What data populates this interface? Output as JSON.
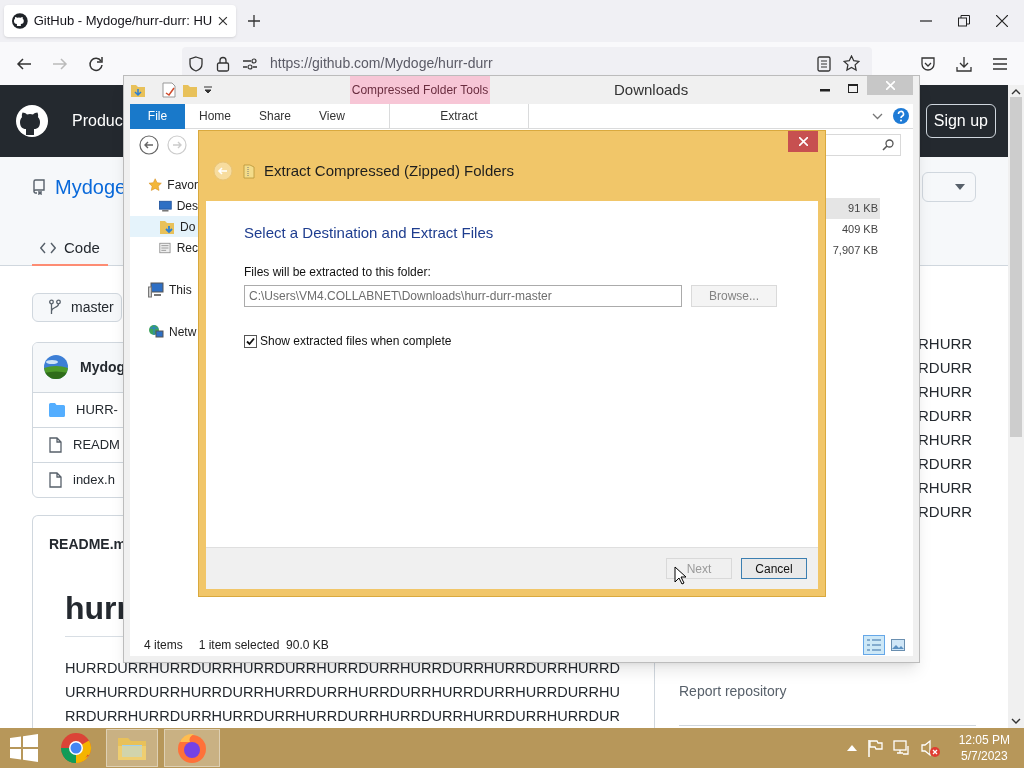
{
  "browser": {
    "tab": {
      "title": "GitHub - Mydoge/hurr-durr: HU",
      "selected": true
    },
    "url": "https://github.com/Mydoge/hurr-durr"
  },
  "github": {
    "nav_item": "Produc",
    "sign_up": "Sign up",
    "repo_name": "Mydoge",
    "repo_tabs": [
      {
        "label": "Code",
        "selected": true
      }
    ],
    "branch": "master",
    "commit_author": "Mydog",
    "files": [
      {
        "kind": "folder",
        "name": "HURR-"
      },
      {
        "kind": "file",
        "name": "READM"
      },
      {
        "kind": "file",
        "name": "index.h"
      }
    ],
    "readme": {
      "title": "README.m",
      "heading": "hurr",
      "lines": [
        "HURRDURRHURRDURRHURRDURRHURRDURRHURRDURRHURRDURRHURRD",
        "URRHURRDURRHURRDURRHURRDURRHURRDURRHURRDURRHURRDURRHU",
        "RRDURRHURRDURRHURRDURRHURRDURRHURRDURRHURRDURRHURRDUR"
      ]
    },
    "side_lines": [
      "RHURR",
      "RDURR",
      "RHURR",
      "RDURR",
      "RHURR",
      "RDURR",
      "RHURR",
      "RDURR"
    ],
    "report_link": "Report repository"
  },
  "explorer": {
    "title": "Downloads",
    "context_group": "Compressed Folder Tools",
    "ribbon_tabs": [
      {
        "label": "File",
        "kind": "menu"
      },
      {
        "label": "Home",
        "kind": "tab"
      },
      {
        "label": "Share",
        "kind": "tab"
      },
      {
        "label": "View",
        "kind": "tab"
      },
      {
        "label": "Extract",
        "kind": "context"
      }
    ],
    "nav_items": [
      {
        "label": "Favor",
        "kind": "favorites",
        "selected": false,
        "children": [
          {
            "label": "Des",
            "kind": "desktop",
            "selected": false
          },
          {
            "label": "Do",
            "kind": "downloads",
            "selected": true
          },
          {
            "label": "Rec",
            "kind": "recent",
            "selected": false
          }
        ]
      },
      {
        "label": "This",
        "kind": "pc",
        "selected": false
      },
      {
        "label": "Netw",
        "kind": "network",
        "selected": false
      }
    ],
    "sizes": [
      {
        "text": "91 KB",
        "selected": true
      },
      {
        "text": "409 KB",
        "selected": false
      },
      {
        "text": "7,907 KB",
        "selected": false
      }
    ],
    "status": {
      "count": "4 items",
      "selection": "1 item selected  90.0 KB"
    },
    "views": [
      {
        "kind": "details",
        "selected": true
      },
      {
        "kind": "thumbnails",
        "selected": false
      }
    ]
  },
  "dialog": {
    "title": "Extract Compressed (Zipped) Folders",
    "heading": "Select a Destination and Extract Files",
    "folder_label": "Files will be extracted to this folder:",
    "folder_value": "C:\\Users\\VM4.COLLABNET\\Downloads\\hurr-durr-master",
    "browse": {
      "label": "Browse...",
      "disabled": true
    },
    "show_files": {
      "label": "Show extracted files when complete",
      "checked": true
    },
    "buttons": [
      {
        "label": "Next",
        "disabled": true
      },
      {
        "label": "Cancel",
        "disabled": false
      }
    ]
  },
  "taskbar": {
    "apps": [
      {
        "kind": "chrome",
        "selected": false
      },
      {
        "kind": "explorer",
        "selected": true
      },
      {
        "kind": "firefox",
        "selected": true
      }
    ],
    "time": "12:05 PM",
    "date": "5/7/2023"
  }
}
